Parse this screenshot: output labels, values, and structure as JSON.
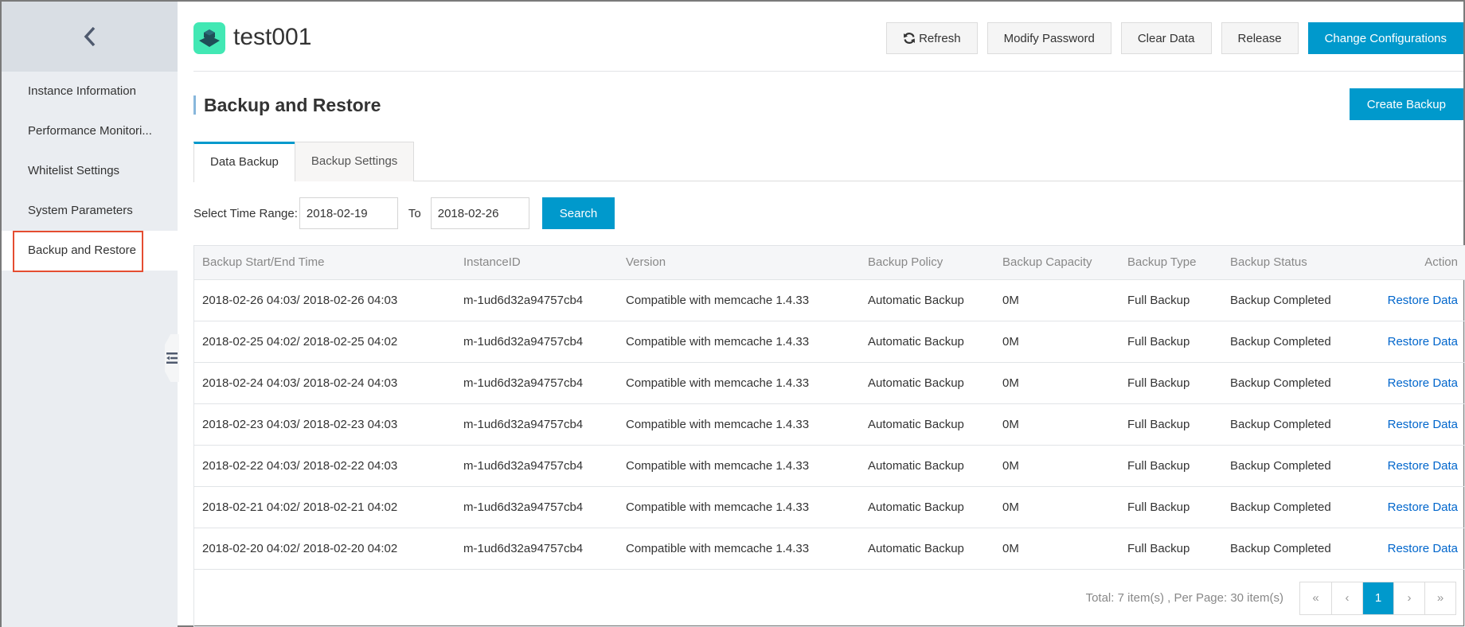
{
  "sidebar": {
    "back_icon": "chevron-left-icon",
    "items": [
      {
        "label": "Instance Information",
        "active": false
      },
      {
        "label": "Performance Monitori...",
        "active": false
      },
      {
        "label": "Whitelist Settings",
        "active": false
      },
      {
        "label": "System Parameters",
        "active": false
      },
      {
        "label": "Backup and Restore",
        "active": true
      }
    ],
    "collapse_icon": "collapse-sidebar-icon"
  },
  "header": {
    "instance_name": "test001",
    "app_icon": "memcache-instance-icon",
    "buttons": {
      "refresh": "Refresh",
      "modify_password": "Modify Password",
      "clear_data": "Clear Data",
      "release": "Release",
      "change_configurations": "Change Configurations"
    }
  },
  "section": {
    "title": "Backup and Restore",
    "create_backup": "Create Backup"
  },
  "tabs": [
    {
      "label": "Data Backup",
      "active": true
    },
    {
      "label": "Backup Settings",
      "active": false
    }
  ],
  "filter": {
    "label": "Select Time Range:",
    "from_value": "2018-02-19",
    "to_label": "To",
    "to_value": "2018-02-26",
    "search_label": "Search"
  },
  "table": {
    "columns": [
      "Backup Start/End Time",
      "InstanceID",
      "Version",
      "Backup Policy",
      "Backup Capacity",
      "Backup Type",
      "Backup Status",
      "Action"
    ],
    "rows": [
      {
        "time": "2018-02-26 04:03/ 2018-02-26 04:03",
        "instance_id": "m-1ud6d32a94757cb4",
        "version": "Compatible with memcache 1.4.33",
        "policy": "Automatic Backup",
        "capacity": "0M",
        "type": "Full Backup",
        "status": "Backup Completed",
        "action": "Restore Data"
      },
      {
        "time": "2018-02-25 04:02/ 2018-02-25 04:02",
        "instance_id": "m-1ud6d32a94757cb4",
        "version": "Compatible with memcache 1.4.33",
        "policy": "Automatic Backup",
        "capacity": "0M",
        "type": "Full Backup",
        "status": "Backup Completed",
        "action": "Restore Data"
      },
      {
        "time": "2018-02-24 04:03/ 2018-02-24 04:03",
        "instance_id": "m-1ud6d32a94757cb4",
        "version": "Compatible with memcache 1.4.33",
        "policy": "Automatic Backup",
        "capacity": "0M",
        "type": "Full Backup",
        "status": "Backup Completed",
        "action": "Restore Data"
      },
      {
        "time": "2018-02-23 04:03/ 2018-02-23 04:03",
        "instance_id": "m-1ud6d32a94757cb4",
        "version": "Compatible with memcache 1.4.33",
        "policy": "Automatic Backup",
        "capacity": "0M",
        "type": "Full Backup",
        "status": "Backup Completed",
        "action": "Restore Data"
      },
      {
        "time": "2018-02-22 04:03/ 2018-02-22 04:03",
        "instance_id": "m-1ud6d32a94757cb4",
        "version": "Compatible with memcache 1.4.33",
        "policy": "Automatic Backup",
        "capacity": "0M",
        "type": "Full Backup",
        "status": "Backup Completed",
        "action": "Restore Data"
      },
      {
        "time": "2018-02-21 04:02/ 2018-02-21 04:02",
        "instance_id": "m-1ud6d32a94757cb4",
        "version": "Compatible with memcache 1.4.33",
        "policy": "Automatic Backup",
        "capacity": "0M",
        "type": "Full Backup",
        "status": "Backup Completed",
        "action": "Restore Data"
      },
      {
        "time": "2018-02-20 04:02/ 2018-02-20 04:02",
        "instance_id": "m-1ud6d32a94757cb4",
        "version": "Compatible with memcache 1.4.33",
        "policy": "Automatic Backup",
        "capacity": "0M",
        "type": "Full Backup",
        "status": "Backup Completed",
        "action": "Restore Data"
      }
    ]
  },
  "pagination": {
    "info": "Total: 7 item(s) ,  Per Page: 30 item(s)",
    "first": "«",
    "prev": "‹",
    "current": "1",
    "next": "›",
    "last": "»"
  },
  "colors": {
    "accent": "#0099cc",
    "link": "#0066cc",
    "highlight_box": "#e54d31",
    "app_icon_bg": "#42e8b4"
  }
}
